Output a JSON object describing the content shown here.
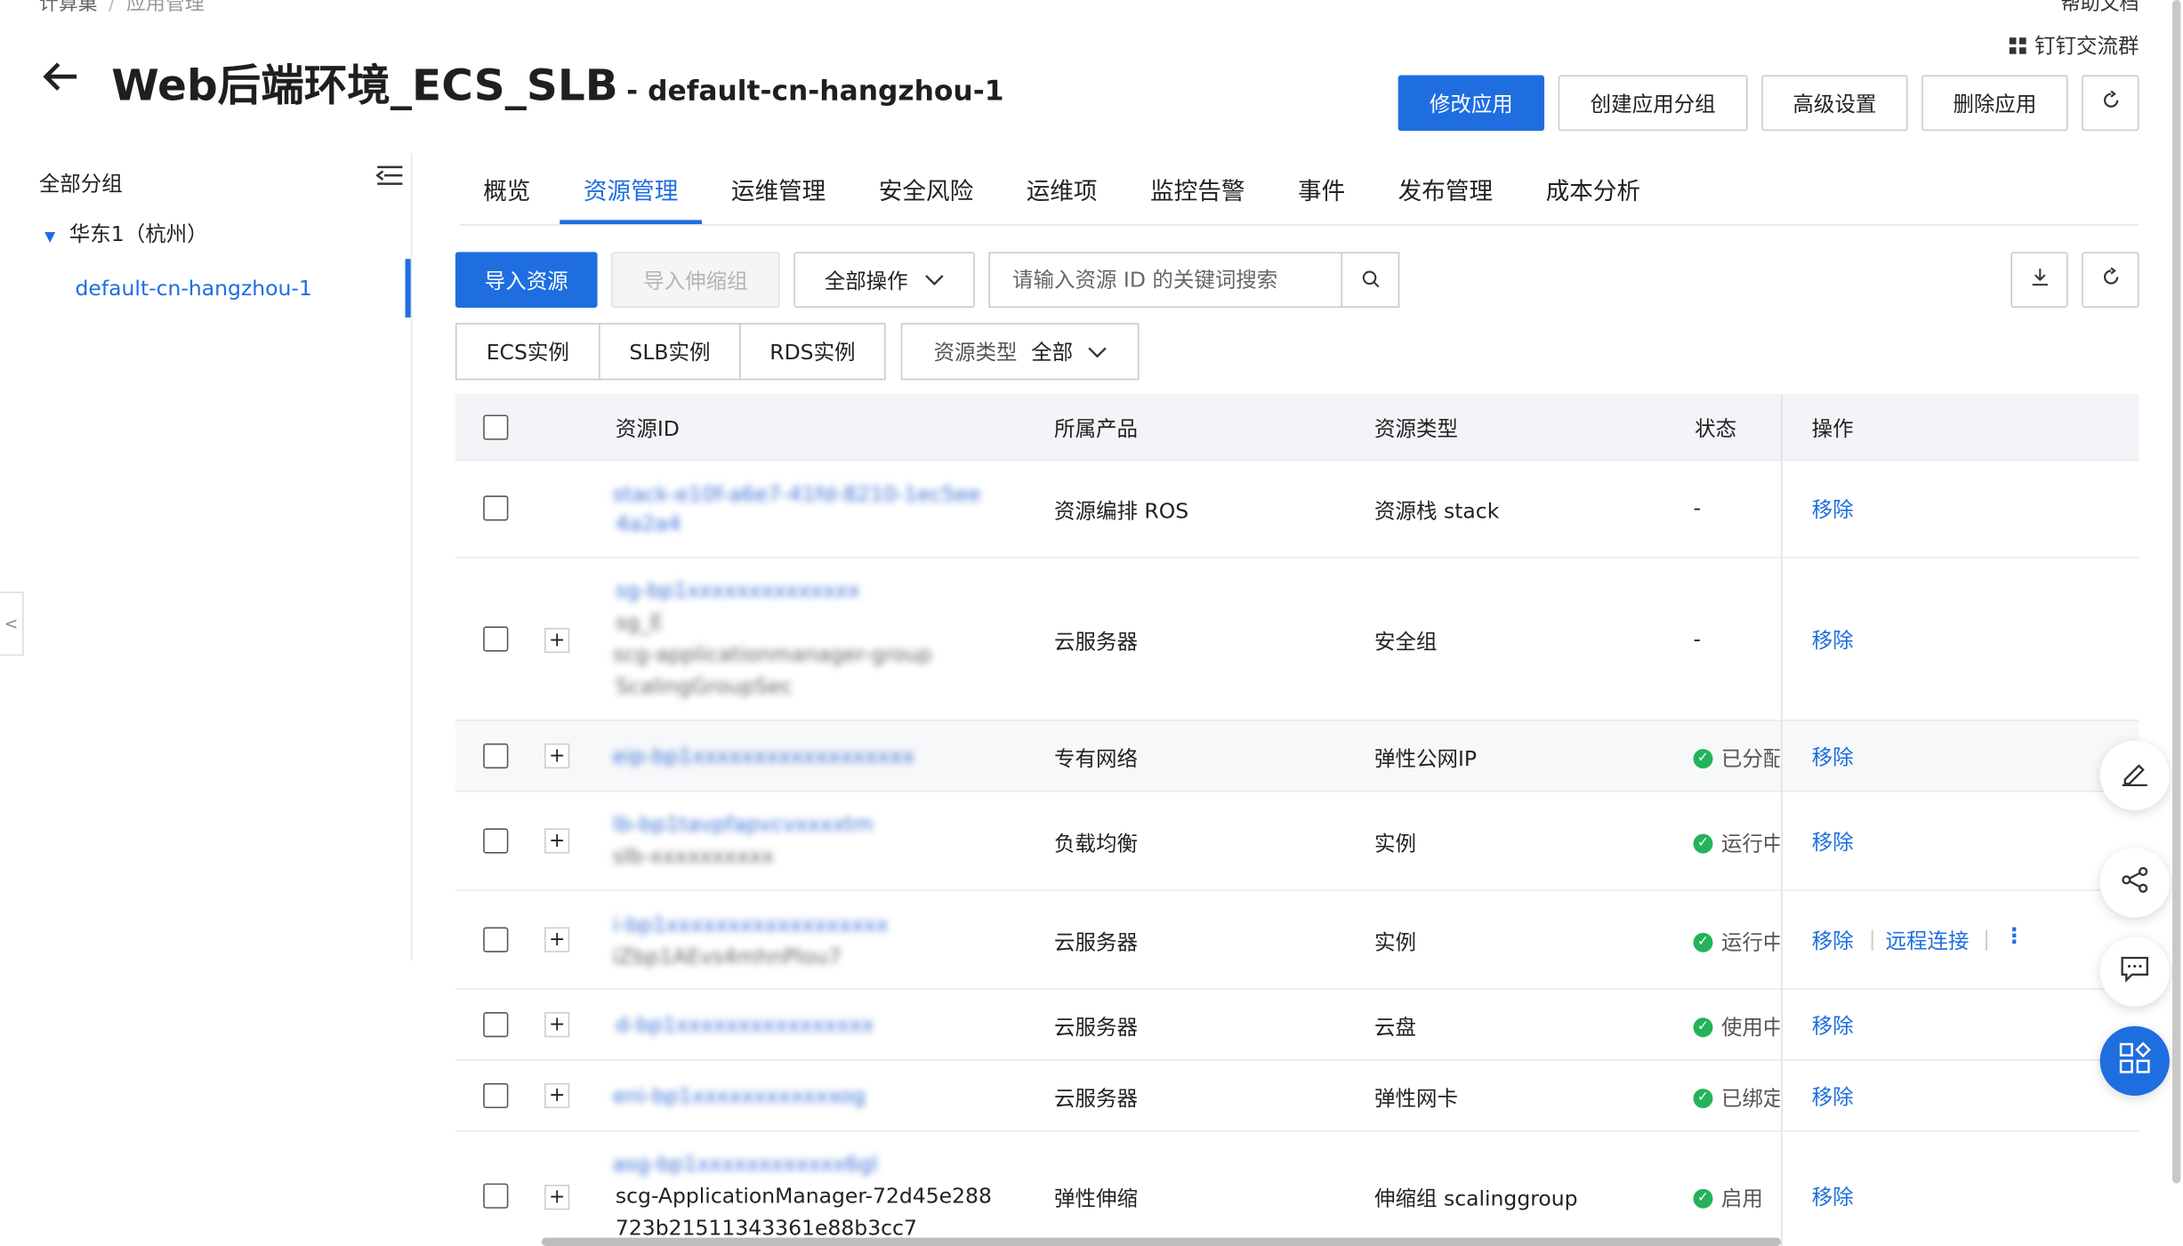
{
  "breadcrumb": {
    "items": [
      "计算巢",
      "应用管理"
    ]
  },
  "topbar": {
    "help_label": "帮助文档",
    "dingtalk_label": "钉钉交流群"
  },
  "page": {
    "title": "Web后端环境_ECS_SLB",
    "subtitle": "- default-cn-hangzhou-1"
  },
  "actions": {
    "modify": "修改应用",
    "create_group": "创建应用分组",
    "advanced": "高级设置",
    "delete": "删除应用"
  },
  "sidebar": {
    "title": "全部分组",
    "region": "华东1（杭州）",
    "item": "default-cn-hangzhou-1"
  },
  "tabs": [
    "概览",
    "资源管理",
    "运维管理",
    "安全风险",
    "运维项",
    "监控告警",
    "事件",
    "发布管理",
    "成本分析"
  ],
  "active_tab": "资源管理",
  "toolbar": {
    "import": "导入资源",
    "import_scaling": "导入伸缩组",
    "all_ops": "全部操作",
    "search_placeholder": "请输入资源 ID 的关键词搜索"
  },
  "filters": {
    "ecs": "ECS实例",
    "slb": "SLB实例",
    "rds": "RDS实例",
    "type_label": "资源类型",
    "type_value": "全部"
  },
  "table": {
    "headers": {
      "id": "资源ID",
      "product": "所属产品",
      "type": "资源类型",
      "status": "状态",
      "ops": "操作"
    },
    "rows": [
      {
        "id_line1": "stack-e10f-a6e7-41fd-8210-1ec5ee",
        "id_line2": "4a2a4",
        "product": "资源编排 ROS",
        "type": "资源栈 stack",
        "status": "-",
        "ops": [
          "移除"
        ]
      },
      {
        "id_line1": "sg-bp1xxxxxxxxxxxxxx",
        "id_line2": "sg_E",
        "id_line3": "scg-applicationmanager-group",
        "id_line4": "ScalingGroupSec",
        "product": "云服务器",
        "type": "安全组",
        "status": "-",
        "ops": [
          "移除"
        ]
      },
      {
        "id_line1": "eip-bp1xxxxxxxxxxxxxxxxxx",
        "product": "专有网络",
        "type": "弹性公网IP",
        "status": "已分配",
        "ops": [
          "移除"
        ]
      },
      {
        "id_line1": "lb-bp1tavpfapvcvxxxxtm",
        "id_line2": "slb-xxxxxxxxxx",
        "product": "负载均衡",
        "type": "实例",
        "status": "运行中",
        "ops": [
          "移除"
        ]
      },
      {
        "id_line1": "i-bp1xxxxxxxxxxxxxxxxxx",
        "id_line2": "iZbp1AEvs4mhnPIou7",
        "product": "云服务器",
        "type": "实例",
        "status": "运行中",
        "ops": [
          "移除",
          "远程连接"
        ]
      },
      {
        "id_line1": "d-bp1xxxxxxxxxxxxxxxx",
        "product": "云服务器",
        "type": "云盘",
        "status": "使用中",
        "ops": [
          "移除"
        ]
      },
      {
        "id_line1": "eni-bp1xxxxxxxxxxxxog",
        "product": "云服务器",
        "type": "弹性网卡",
        "status": "已绑定",
        "ops": [
          "移除"
        ]
      },
      {
        "id_line1": "asg-bp1xxxxxxxxxxxx6gl",
        "id_line2": "scg-ApplicationManager-72d45e288",
        "id_line3": "723b21511343361e88b3cc7",
        "product": "弹性伸缩",
        "type": "伸缩组 scalinggroup",
        "status": "启用",
        "ops": [
          "移除"
        ]
      }
    ]
  }
}
